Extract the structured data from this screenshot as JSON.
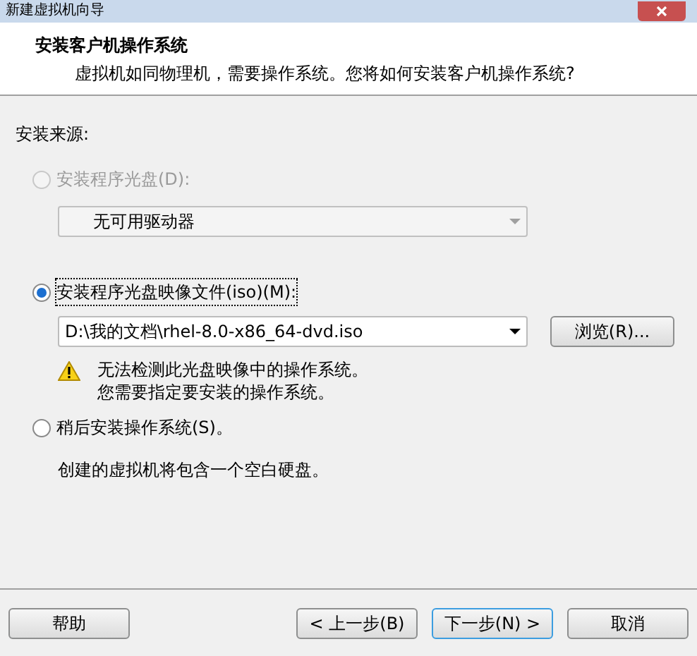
{
  "window": {
    "title": "新建虚拟机向导"
  },
  "header": {
    "title": "安装客户机操作系统",
    "subtitle": "虚拟机如同物理机，需要操作系统。您将如何安装客户机操作系统?"
  },
  "source_label": "安装来源:",
  "options": [
    {
      "kind": "drive",
      "label": "安装程序光盘(D):",
      "selected": false,
      "disabled": true,
      "dropdown": {
        "value": "无可用驱动器",
        "disabled": true
      }
    },
    {
      "kind": "iso",
      "label": "安装程序光盘映像文件(iso)(M):",
      "selected": true,
      "disabled": false,
      "dropdown": {
        "value": "D:\\我的文档\\rhel-8.0-x86_64-dvd.iso",
        "disabled": false
      },
      "browse_button": "浏览(R)...",
      "warning": [
        "无法检测此光盘映像中的操作系统。",
        "您需要指定要安装的操作系统。"
      ]
    },
    {
      "kind": "later",
      "label": "稍后安装操作系统(S)。",
      "selected": false,
      "disabled": false,
      "note": "创建的虚拟机将包含一个空白硬盘。"
    }
  ],
  "buttons": [
    {
      "label": "帮助",
      "default": false
    },
    {
      "label": "< 上一步(B)",
      "default": false
    },
    {
      "label": "下一步(N) >",
      "default": true
    },
    {
      "label": "取消",
      "default": false
    }
  ]
}
